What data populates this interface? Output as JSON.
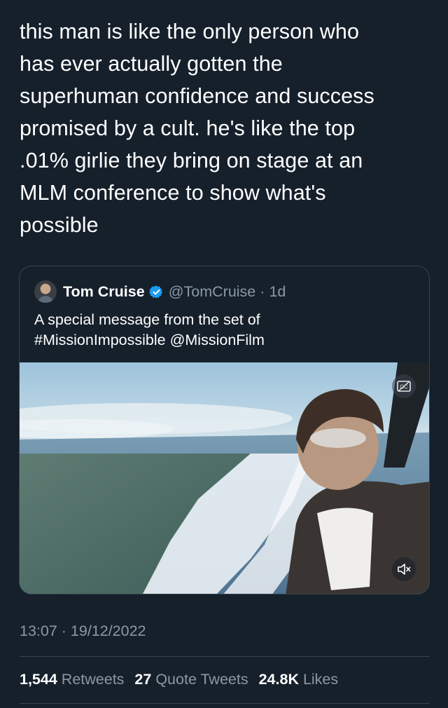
{
  "tweet": {
    "text": "this man is like the only person who\nhas ever actually gotten the\nsuperhuman confidence and success\npromised by a cult. he's like the top\n.01% girlie they bring on stage at an\nMLM conference to show what's\npossible"
  },
  "quoted_tweet": {
    "name": "Tom Cruise",
    "handle": "@TomCruise",
    "separator": "·",
    "time": "1d",
    "verified": true,
    "body_lines": [
      "A special message from the set of",
      "#MissionImpossible @MissionFilm"
    ],
    "media": {
      "type": "video",
      "controls": [
        "captions-icon",
        "mute-icon"
      ]
    }
  },
  "meta": {
    "timestamp": "13:07 · 19/12/2022"
  },
  "stats": [
    {
      "value": "1,544",
      "label": "Retweets"
    },
    {
      "value": "27",
      "label": "Quote Tweets"
    },
    {
      "value": "24.8K",
      "label": "Likes"
    }
  ],
  "colors": {
    "background": "#15202b",
    "border": "#38444d",
    "secondary_text": "#8b98a5",
    "verified_blue": "#1d9bf0"
  }
}
